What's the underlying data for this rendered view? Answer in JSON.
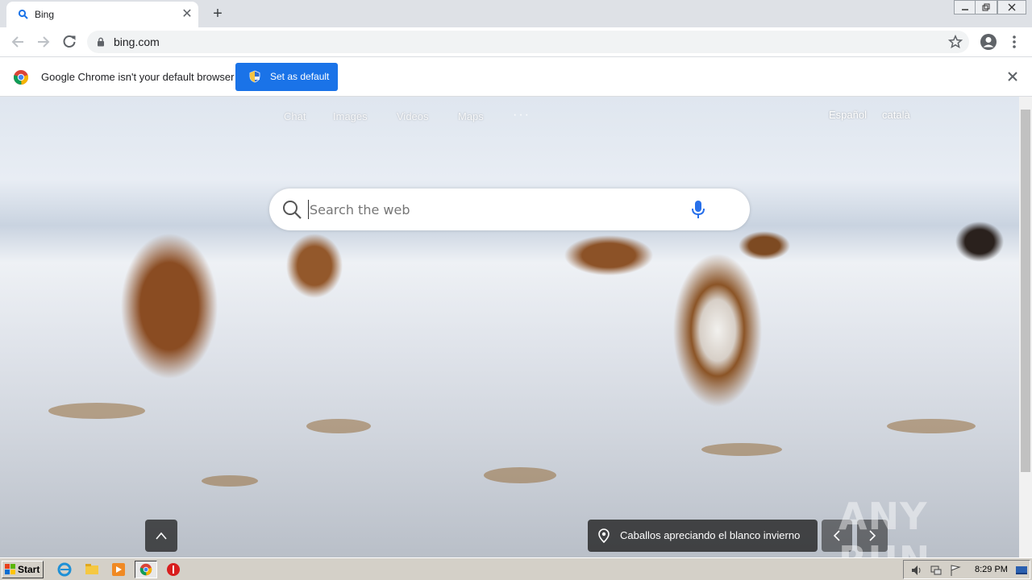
{
  "browser": {
    "tab": {
      "title": "Bing"
    },
    "address": {
      "url": "bing.com"
    },
    "infobar": {
      "message": "Google Chrome isn't your default browser",
      "button": "Set as default"
    }
  },
  "bing": {
    "nav": [
      "Chat",
      "Images",
      "Videos",
      "Maps"
    ],
    "more": "···",
    "languages": [
      "Español",
      "català"
    ],
    "search": {
      "placeholder": "Search the web"
    },
    "caption": "Caballos apreciando el blanco invierno",
    "watermark": "ANY RUN"
  },
  "taskbar": {
    "start": "Start",
    "clock": "8:29 PM"
  },
  "colors": {
    "accent": "#1a73e8",
    "bing_mic": "#2870ea",
    "tab_strip": "#dee1e6",
    "taskbar": "#d4d0c8"
  },
  "icons": [
    "search-icon",
    "microphone-icon",
    "lock-icon",
    "star-icon",
    "profile-icon",
    "menu-icon",
    "shield-icon",
    "location-pin-icon",
    "chevron-up-icon",
    "chevron-left-icon",
    "chevron-right-icon"
  ]
}
